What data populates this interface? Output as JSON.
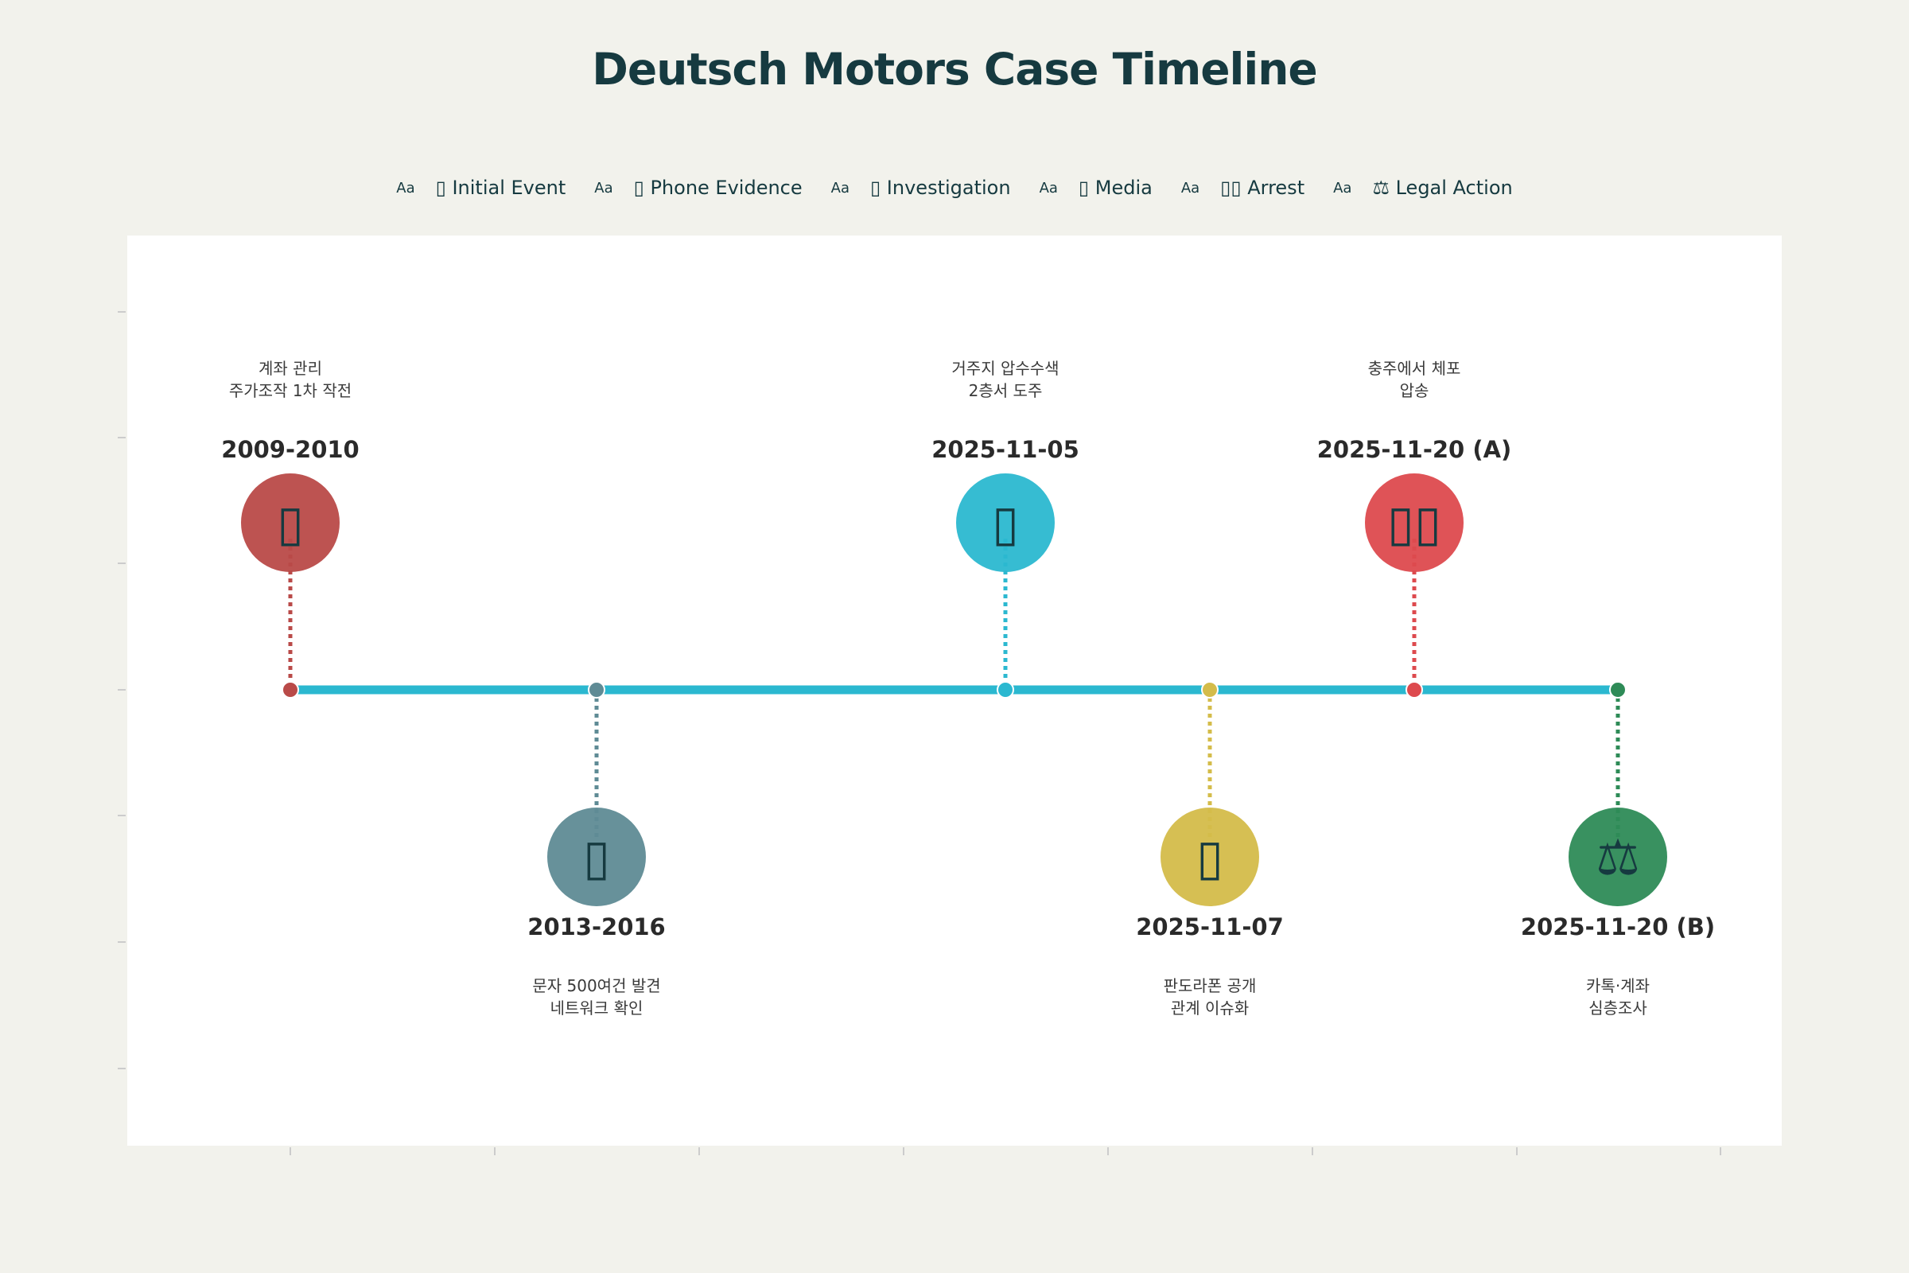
{
  "title": "Deutsch Motors Case Timeline",
  "legend": [
    {
      "marker": "Aa",
      "label": "▯ Initial Event"
    },
    {
      "marker": "Aa",
      "label": "▯ Phone Evidence"
    },
    {
      "marker": "Aa",
      "label": "▯ Investigation"
    },
    {
      "marker": "Aa",
      "label": "▯ Media"
    },
    {
      "marker": "Aa",
      "label": "▯▯ Arrest"
    },
    {
      "marker": "Aa",
      "label": "⚖ Legal Action"
    }
  ],
  "chart_data": {
    "type": "timeline",
    "title": "Deutsch Motors Case Timeline",
    "grid": false,
    "legend_position": "top",
    "events": [
      {
        "date": "2009-2010",
        "desc_lines": [
          "계좌 관리",
          "주가조작 1차 작전"
        ],
        "icon": "▯",
        "category": "Initial Event",
        "color": "#b94a48",
        "side": "above"
      },
      {
        "date": "2013-2016",
        "desc_lines": [
          "문자 500여건 발견",
          "네트워크 확인"
        ],
        "icon": "▯",
        "category": "Phone Evidence",
        "color": "#5f8b95",
        "side": "below"
      },
      {
        "date": "2025-11-05",
        "desc_lines": [
          "거주지 압수수색",
          "2층서 도주"
        ],
        "icon": "▯",
        "category": "Investigation",
        "color": "#2bb8d0",
        "side": "above"
      },
      {
        "date": "2025-11-07",
        "desc_lines": [
          "판도라폰 공개",
          "관계 이슈화"
        ],
        "icon": "▯",
        "category": "Media",
        "color": "#d4bc4a",
        "side": "below"
      },
      {
        "date": "2025-11-20 (A)",
        "desc_lines": [
          "충주에서 체포",
          "압송"
        ],
        "icon": "▯▯",
        "category": "Arrest",
        "color": "#dd4a4e",
        "side": "above"
      },
      {
        "date": "2025-11-20 (B)",
        "desc_lines": [
          "카톡·계좌",
          "심층조사"
        ],
        "icon": "⚖",
        "category": "Legal Action",
        "color": "#2e8b57",
        "side": "below"
      }
    ],
    "axis_color": "#2bb8d0"
  }
}
